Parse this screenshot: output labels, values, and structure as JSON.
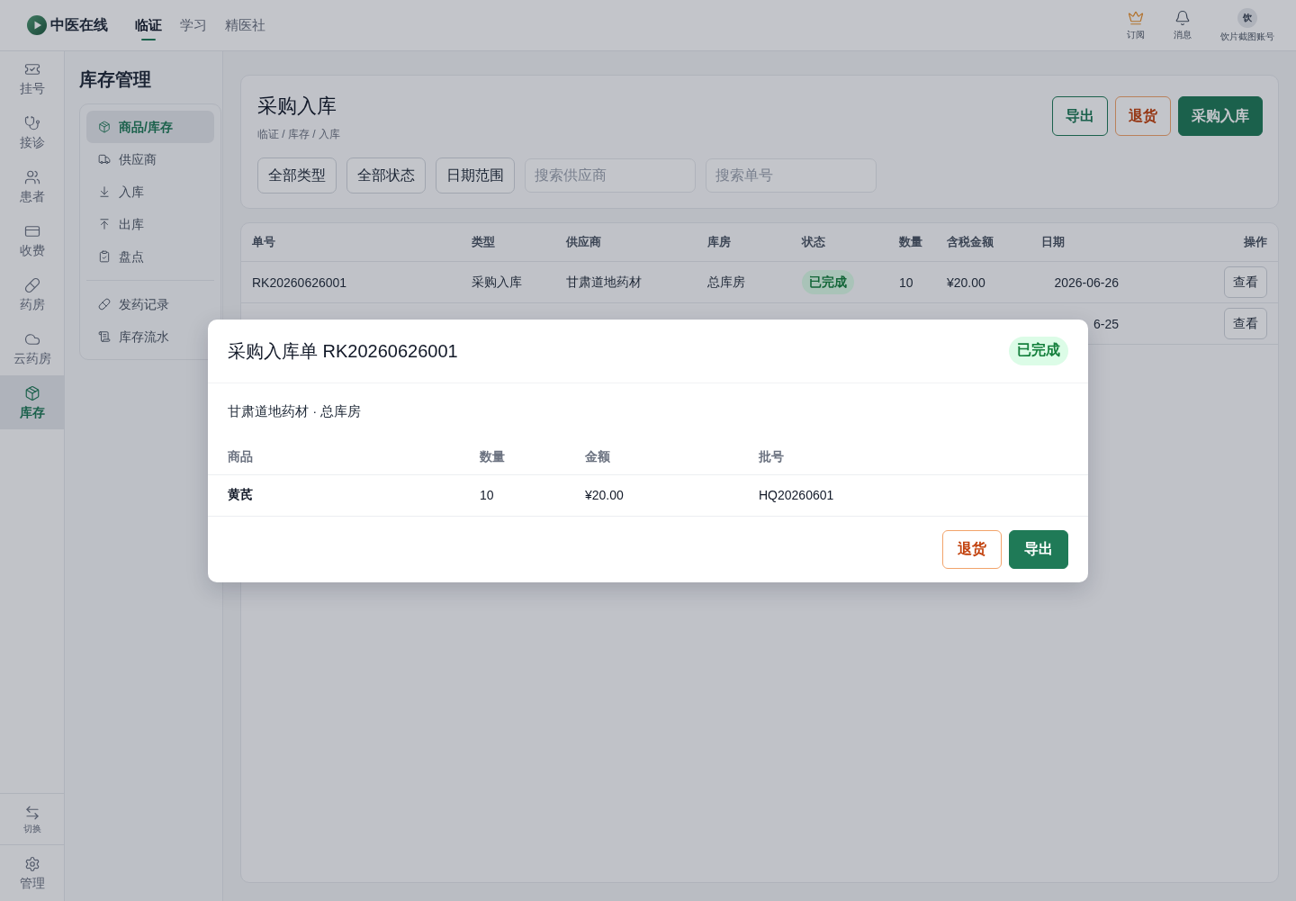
{
  "top_bar": {
    "brand": "中医在线",
    "nav": [
      {
        "label": "临证",
        "selected": true
      },
      {
        "label": "学习",
        "selected": false
      },
      {
        "label": "精医社",
        "selected": false
      }
    ],
    "actions": [
      {
        "kind": "icon",
        "label": "订阅"
      },
      {
        "kind": "icon",
        "label": "消息"
      },
      {
        "kind": "avatar",
        "avatar": "饮",
        "label": "饮片截图账号"
      }
    ]
  },
  "rail": {
    "items": [
      {
        "label": "挂号",
        "selected": false
      },
      {
        "label": "接诊",
        "selected": false
      },
      {
        "label": "患者",
        "selected": false
      },
      {
        "label": "收费",
        "selected": false
      },
      {
        "label": "药房",
        "selected": false
      },
      {
        "label": "云药房",
        "selected": false
      },
      {
        "label": "库存",
        "selected": true
      }
    ],
    "footer": [
      {
        "kind": "small",
        "label": "切换"
      },
      {
        "kind": "normal",
        "label": "管理"
      }
    ]
  },
  "sub_nav": {
    "title": "库存管理",
    "sections": [
      {
        "items": [
          {
            "label": "商品/库存",
            "selected": true
          },
          {
            "label": "供应商",
            "selected": false
          },
          {
            "label": "入库",
            "selected": false
          },
          {
            "label": "出库",
            "selected": false
          },
          {
            "label": "盘点",
            "selected": false
          }
        ]
      },
      {
        "items": [
          {
            "label": "发药记录",
            "selected": false
          },
          {
            "label": "库存流水",
            "selected": false
          }
        ]
      }
    ]
  },
  "page": {
    "title": "采购入库",
    "breadcrumb": "临证 / 库存 / 入库",
    "actions": [
      {
        "label": "导出",
        "kind": "outline"
      },
      {
        "label": "退货",
        "kind": "danger"
      },
      {
        "label": "采购入库",
        "kind": "primary"
      }
    ],
    "filters": [
      {
        "kind": "select",
        "label": "全部类型"
      },
      {
        "kind": "select",
        "label": "全部状态"
      },
      {
        "kind": "select",
        "label": "日期范围"
      },
      {
        "kind": "search",
        "placeholder": "搜索供应商"
      },
      {
        "kind": "search",
        "placeholder": "搜索单号"
      }
    ]
  },
  "table": {
    "columns": [
      "单号",
      "类型",
      "供应商",
      "库房",
      "状态",
      "数量",
      "含税金额",
      "日期",
      "操作"
    ],
    "rows": [
      {
        "order_no": "RK20260626001",
        "type": "采购入库",
        "supplier": "甘肃道地药材",
        "warehouse": "总库房",
        "status": "已完成",
        "quantity": "10",
        "amount": "¥20.00",
        "date": "2026-06-26",
        "action": "查看"
      },
      {
        "date": "6-25",
        "action": "查看"
      }
    ]
  },
  "dialog": {
    "title": "采购入库单 RK20260626001",
    "status": "已完成",
    "subtitle": "甘肃道地药材 · 总库房",
    "columns": [
      "商品",
      "数量",
      "金额",
      "批号"
    ],
    "rows": [
      {
        "product": "黄芪",
        "quantity": "10",
        "amount": "¥20.00",
        "batch": "HQ20260601"
      }
    ],
    "actions": [
      {
        "label": "退货",
        "kind": "danger"
      },
      {
        "label": "导出",
        "kind": "primary"
      }
    ]
  }
}
